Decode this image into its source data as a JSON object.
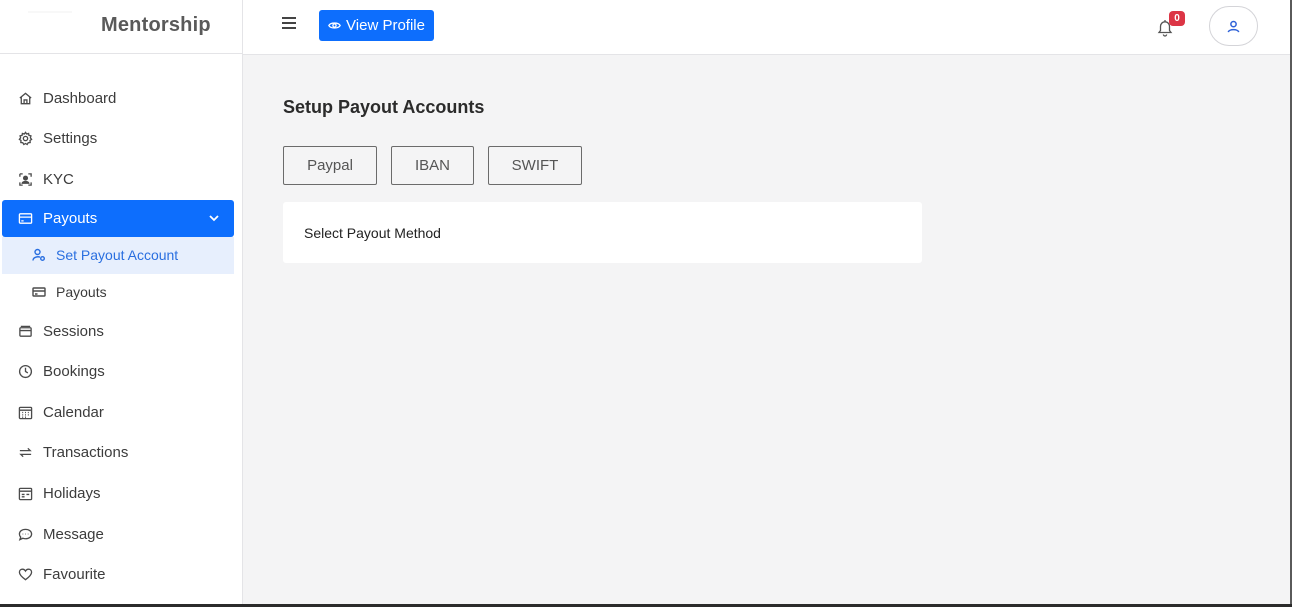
{
  "brand": {
    "title": "Mentorship"
  },
  "sidebar": {
    "items": [
      {
        "label": "Dashboard",
        "icon": "home-icon"
      },
      {
        "label": "Settings",
        "icon": "gear-icon"
      },
      {
        "label": "KYC",
        "icon": "id-card-icon"
      },
      {
        "label": "Payouts",
        "icon": "credit-card-icon",
        "active": true,
        "expanded": true
      },
      {
        "label": "Sessions",
        "icon": "sessions-icon"
      },
      {
        "label": "Bookings",
        "icon": "clock-icon"
      },
      {
        "label": "Calendar",
        "icon": "calendar-icon"
      },
      {
        "label": "Transactions",
        "icon": "transfer-icon"
      },
      {
        "label": "Holidays",
        "icon": "calendar-week-icon"
      },
      {
        "label": "Message",
        "icon": "chat-icon"
      },
      {
        "label": "Favourite",
        "icon": "heart-icon"
      }
    ],
    "payouts_sub": [
      {
        "label": "Set Payout Account",
        "icon": "user-gear-icon",
        "selected": true
      },
      {
        "label": "Payouts",
        "icon": "credit-card-icon"
      }
    ]
  },
  "topbar": {
    "view_profile_label": "View Profile",
    "notification_count": "0"
  },
  "main": {
    "title": "Setup Payout Accounts",
    "methods": [
      "Paypal",
      "IBAN",
      "SWIFT"
    ],
    "card_text": "Select Payout Method"
  },
  "colors": {
    "primary": "#0d6efd",
    "badge": "#dc3545",
    "selected_bg": "#e7effd",
    "background": "#f4f4f5"
  }
}
